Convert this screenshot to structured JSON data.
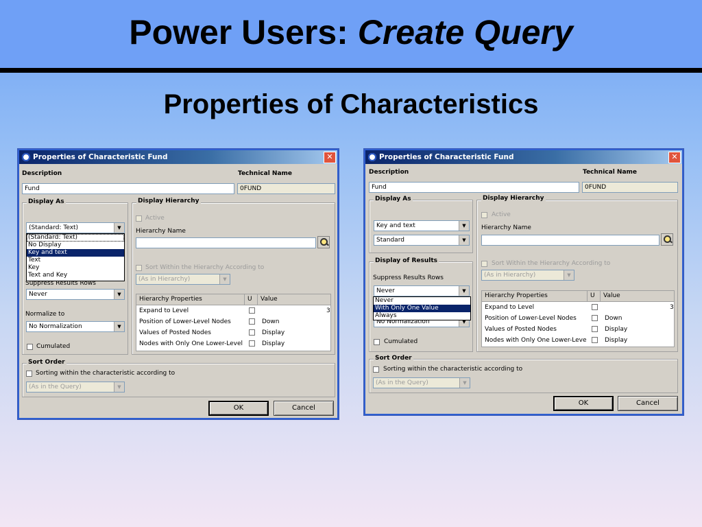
{
  "slide": {
    "title_main": "Power Users:",
    "title_emph": "Create Query",
    "subtitle": "Properties of Characteristics"
  },
  "dialog1": {
    "title": "Properties of Characteristic Fund",
    "description_label": "Description",
    "technical_label": "Technical Name",
    "description_value": "Fund",
    "technical_value": "0FUND",
    "display_as_label": "Display As",
    "display_as_selected": "(Standard: Text)",
    "display_as_options": [
      "(Standard: Text)",
      "No Display",
      "Key and text",
      "Text",
      "Key",
      "Text and Key"
    ],
    "suppress_label": "Suppress Results Rows",
    "suppress_value": "Never",
    "normalize_label": "Normalize to",
    "normalize_value": "No Normalization",
    "cumulated_label": "Cumulated",
    "display_hierarchy_label": "Display Hierarchy",
    "active_label": "Active",
    "hierarchy_name_label": "Hierarchy Name",
    "sort_within_label": "Sort Within the Hierarchy According to",
    "as_in_hierarchy": "(As in Hierarchy)",
    "hp_headers": [
      "Hierarchy Properties",
      "U",
      "Value"
    ],
    "hp_rows": [
      {
        "name": "Expand to Level",
        "value": "3"
      },
      {
        "name": "Position of Lower-Level Nodes",
        "value": "Down"
      },
      {
        "name": "Values of Posted Nodes",
        "value": "Display"
      },
      {
        "name": "Nodes with Only One Lower-Level Nc",
        "value": "Display"
      }
    ],
    "sort_order_label": "Sort Order",
    "sorting_within_label": "Sorting within the characteristic according to",
    "as_in_query": "(As in the Query)",
    "ok": "OK",
    "cancel": "Cancel"
  },
  "dialog2": {
    "title": "Properties of Characteristic Fund",
    "description_label": "Description",
    "technical_label": "Technical Name",
    "description_value": "Fund",
    "technical_value": "0FUND",
    "display_as_label": "Display As",
    "display_as_value1": "Key and text",
    "display_as_value2": "Standard",
    "display_results_label": "Display of Results",
    "suppress_label": "Suppress Results Rows",
    "suppress_value": "Never",
    "suppress_options": [
      "Never",
      "With Only One Value",
      "Always"
    ],
    "normalize_value": "No Normalization",
    "cumulated_label": "Cumulated",
    "display_hierarchy_label": "Display Hierarchy",
    "active_label": "Active",
    "hierarchy_name_label": "Hierarchy Name",
    "sort_within_label": "Sort Within the Hierarchy According to",
    "as_in_hierarchy": "(As in Hierarchy)",
    "hp_headers": [
      "Hierarchy Properties",
      "U",
      "Value"
    ],
    "hp_rows": [
      {
        "name": "Expand to Level",
        "value": "3"
      },
      {
        "name": "Position of Lower-Level Nodes",
        "value": "Down"
      },
      {
        "name": "Values of Posted Nodes",
        "value": "Display"
      },
      {
        "name": "Nodes with Only One Lower-Level Nc",
        "value": "Display"
      }
    ],
    "sort_order_label": "Sort Order",
    "sorting_within_label": "Sorting within the characteristic according to",
    "as_in_query": "(As in the Query)",
    "ok": "OK",
    "cancel": "Cancel"
  }
}
